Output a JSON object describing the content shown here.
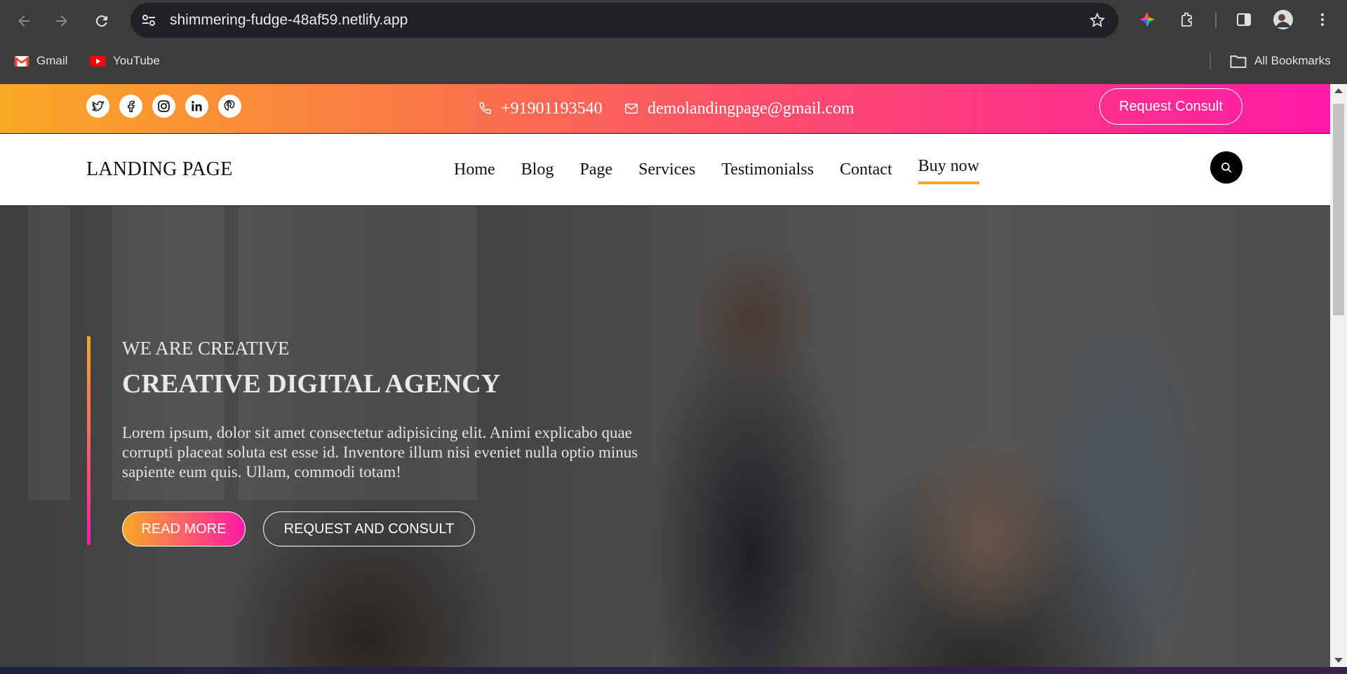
{
  "browser": {
    "url": "shimmering-fudge-48af59.netlify.app",
    "bookmarks": [
      {
        "label": "Gmail",
        "icon": "gmail-icon"
      },
      {
        "label": "YouTube",
        "icon": "youtube-icon"
      }
    ],
    "all_bookmarks_label": "All Bookmarks"
  },
  "topbar": {
    "phone": "+91901193540",
    "email": "demolandingpage@gmail.com",
    "consult_label": "Request Consult",
    "socials": [
      "twitter-icon",
      "facebook-icon",
      "instagram-icon",
      "linkedin-icon",
      "pinterest-icon"
    ]
  },
  "nav": {
    "logo": "LANDING PAGE",
    "items": [
      "Home",
      "Blog",
      "Page",
      "Services",
      "Testimonialss",
      "Contact",
      "Buy now"
    ],
    "active": "Buy now"
  },
  "hero": {
    "kicker": "WE ARE CREATIVE",
    "headline": "CREATIVE DIGITAL AGENCY",
    "lead": "Lorem ipsum, dolor sit amet consectetur adipisicing elit. Animi explicabo quae corrupti placeat soluta est esse id. Inventore illum nisi eveniet nulla optio minus sapiente eum quis. Ullam, commodi totam!",
    "read_more": "READ MORE",
    "request_consult": "REQUEST AND CONSULT"
  },
  "colors": {
    "gradient_start": "#f9a826",
    "gradient_end": "#ff1aa6",
    "chrome_bg": "#3c3c3c"
  }
}
